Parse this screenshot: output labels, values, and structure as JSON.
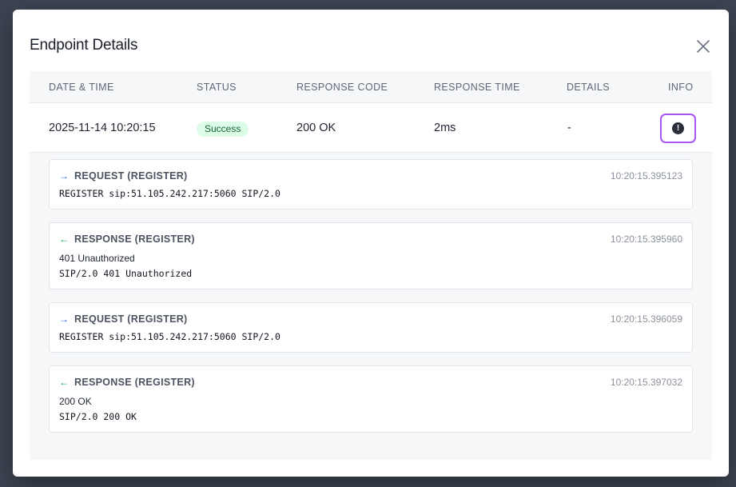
{
  "modal": {
    "title": "Endpoint Details"
  },
  "icons": {
    "close": "close-icon",
    "info": "info-icon",
    "request_arrow": "arrow-right-icon",
    "response_arrow": "arrow-left-icon"
  },
  "colors": {
    "success_badge_bg": "#dcfce7",
    "success_badge_text": "#166534",
    "info_button_border": "#a855f7",
    "request_arrow": "#2563eb",
    "response_arrow": "#16a34a"
  },
  "table": {
    "headers": [
      "DATE & TIME",
      "STATUS",
      "RESPONSE CODE",
      "RESPONSE TIME",
      "DETAILS",
      "INFO"
    ],
    "row": {
      "datetime": "2025-11-14 10:20:15",
      "status": "Success",
      "response_code": "200 OK",
      "response_time": "2ms",
      "details": "-"
    }
  },
  "messages": [
    {
      "direction": "request",
      "arrow": "→",
      "label": "REQUEST (REGISTER)",
      "time": "10:20:15.395123",
      "status_text": "",
      "line": "REGISTER sip:51.105.242.217:5060 SIP/2.0"
    },
    {
      "direction": "response",
      "arrow": "←",
      "label": "RESPONSE (REGISTER)",
      "time": "10:20:15.395960",
      "status_text": "401 Unauthorized",
      "line": "SIP/2.0 401 Unauthorized"
    },
    {
      "direction": "request",
      "arrow": "→",
      "label": "REQUEST (REGISTER)",
      "time": "10:20:15.396059",
      "status_text": "",
      "line": "REGISTER sip:51.105.242.217:5060 SIP/2.0"
    },
    {
      "direction": "response",
      "arrow": "←",
      "label": "RESPONSE (REGISTER)",
      "time": "10:20:15.397032",
      "status_text": "200 OK",
      "line": "SIP/2.0 200 OK"
    }
  ]
}
